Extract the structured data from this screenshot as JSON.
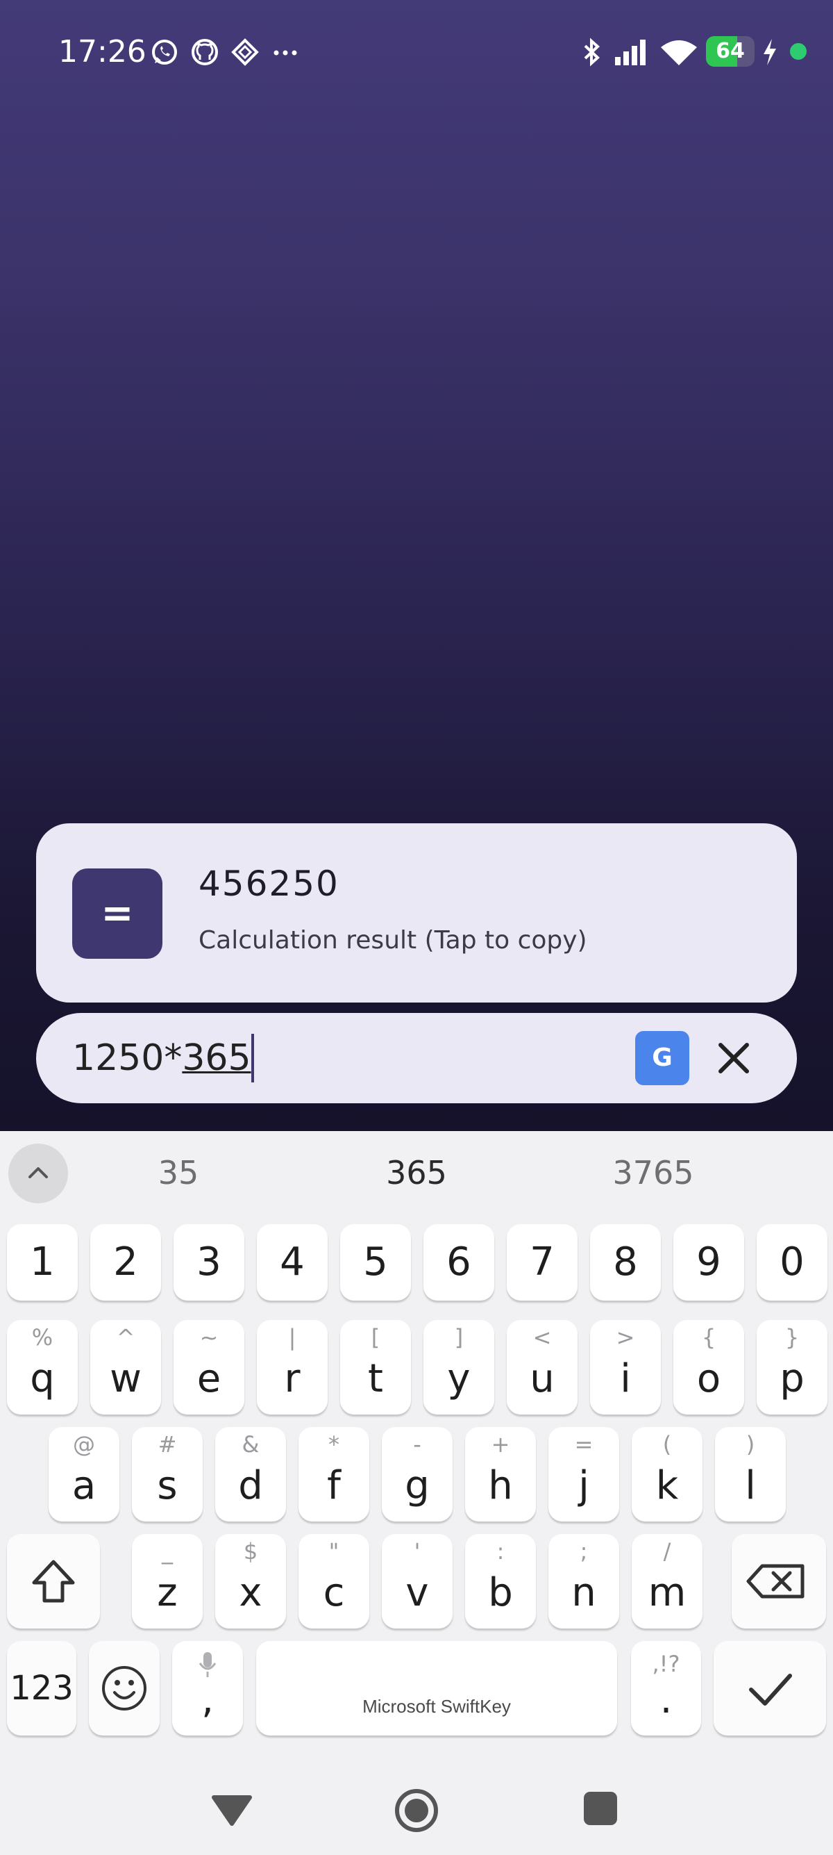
{
  "status_bar": {
    "time": "17:26",
    "notification_icons": [
      "whatsapp-icon",
      "github-icon",
      "app-icon",
      "more-icon"
    ],
    "system_icons": [
      "bluetooth-icon",
      "signal-icon",
      "wifi-icon",
      "battery-icon",
      "charging-icon"
    ],
    "battery_level": "64",
    "battery_fraction": 0.64
  },
  "result_card": {
    "icon_symbol": "=",
    "value": "456250",
    "caption": "Calculation result (Tap to copy)"
  },
  "input_bar": {
    "text_prefix": "1250*",
    "text_composing": "365",
    "g_button_label": "G"
  },
  "keyboard": {
    "suggestions": [
      "35",
      "365",
      "3765"
    ],
    "number_row": [
      "1",
      "2",
      "3",
      "4",
      "5",
      "6",
      "7",
      "8",
      "9",
      "0"
    ],
    "row1": [
      {
        "key": "q",
        "sub": "%"
      },
      {
        "key": "w",
        "sub": "^"
      },
      {
        "key": "e",
        "sub": "~"
      },
      {
        "key": "r",
        "sub": "|"
      },
      {
        "key": "t",
        "sub": "["
      },
      {
        "key": "y",
        "sub": "]"
      },
      {
        "key": "u",
        "sub": "<"
      },
      {
        "key": "i",
        "sub": ">"
      },
      {
        "key": "o",
        "sub": "{"
      },
      {
        "key": "p",
        "sub": "}"
      }
    ],
    "row2": [
      {
        "key": "a",
        "sub": "@"
      },
      {
        "key": "s",
        "sub": "#"
      },
      {
        "key": "d",
        "sub": "&"
      },
      {
        "key": "f",
        "sub": "*"
      },
      {
        "key": "g",
        "sub": "-"
      },
      {
        "key": "h",
        "sub": "+"
      },
      {
        "key": "j",
        "sub": "="
      },
      {
        "key": "k",
        "sub": "("
      },
      {
        "key": "l",
        "sub": ")"
      }
    ],
    "row3": [
      {
        "key": "z",
        "sub": "_"
      },
      {
        "key": "x",
        "sub": "$"
      },
      {
        "key": "c",
        "sub": "\""
      },
      {
        "key": "v",
        "sub": "'"
      },
      {
        "key": "b",
        "sub": ":"
      },
      {
        "key": "n",
        "sub": ";"
      },
      {
        "key": "m",
        "sub": "/"
      }
    ],
    "symbols_key": "123",
    "comma_key": ",",
    "period_key": ".",
    "period_sub": ",!?",
    "space_label": "Microsoft SwiftKey"
  }
}
